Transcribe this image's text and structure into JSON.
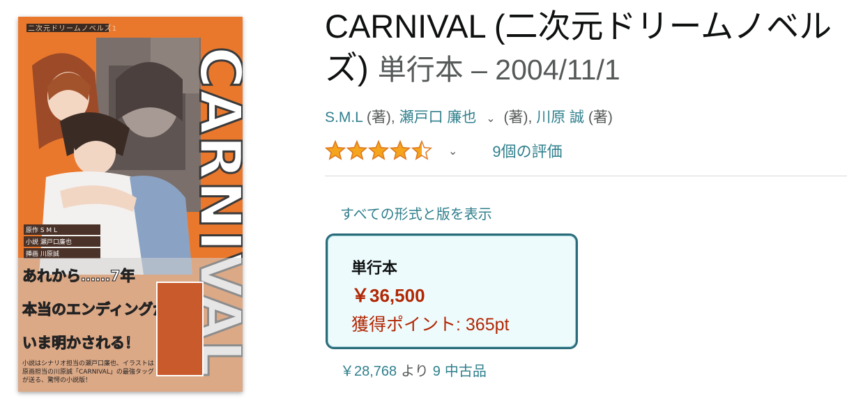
{
  "cover": {
    "subtitle": "二次元ドリームノベルズ1",
    "title": "CARNIVAL",
    "credits": [
      "原作 S M L",
      "小説 瀬戸口廉也",
      "挿画 川原誠"
    ],
    "tagline": [
      "あれから……7年",
      "本当のエンディングが",
      "いま明かされる！"
    ],
    "blurb": [
      "小説はシナリオ担当の瀬戸口廉也、イラストは",
      "原画担当の川原誠「CARNIVAL」の最強タッグ",
      "が送る、驚愕の小説版！"
    ]
  },
  "product": {
    "title": "CARNIVAL (二次元ドリームノベルズ)",
    "binding_date": "単行本 – 2004/11/1"
  },
  "authors": {
    "author1": "S.M.L",
    "author1_role": "(著),",
    "author2": "瀬戸口 廉也",
    "author2_role": "(著),",
    "author3": "川原 誠",
    "author3_role": "(著)"
  },
  "rating": {
    "stars": 4.5,
    "count_label": "9個の評価"
  },
  "formats": {
    "all_label": "すべての形式と版を表示",
    "selected": {
      "name": "単行本",
      "price": "￥36,500",
      "points": "獲得ポイント: 365pt"
    }
  },
  "used": {
    "price": "￥28,768",
    "from": "より",
    "count": "9",
    "condition": "中古品"
  },
  "colors": {
    "link": "#2f7f8c",
    "price": "#b12704",
    "star": "#f4a41d",
    "card_border": "#2b6b7a",
    "card_bg": "#eefbfd",
    "cover_orange": "#e9782d"
  }
}
